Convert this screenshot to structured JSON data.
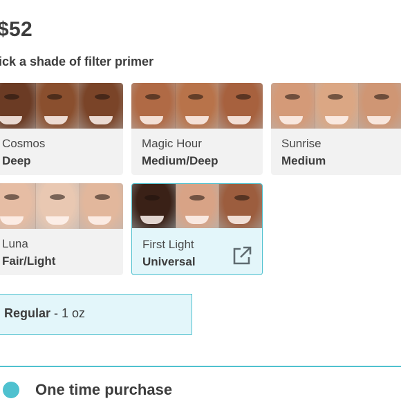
{
  "product": {
    "price": "$52",
    "shade_prompt": "ick a shade of filter primer"
  },
  "shades": [
    {
      "name": "Cosmos",
      "tone": "Deep",
      "selected": false,
      "skin_colors": [
        "#6b3b24",
        "#8a4f2e",
        "#7a4428"
      ]
    },
    {
      "name": "Magic Hour",
      "tone": "Medium/Deep",
      "selected": false,
      "skin_colors": [
        "#b06a45",
        "#b8734a",
        "#a7613e"
      ]
    },
    {
      "name": "Sunrise",
      "tone": "Medium",
      "selected": false,
      "skin_colors": [
        "#d49a78",
        "#dba784",
        "#cf9674"
      ]
    },
    {
      "name": "Luna",
      "tone": "Fair/Light",
      "selected": false,
      "skin_colors": [
        "#e6bda4",
        "#e9c8b2",
        "#e2b79c"
      ]
    },
    {
      "name": "First Light",
      "tone": "Universal",
      "selected": true,
      "skin_colors": [
        "#3a2117",
        "#d8a386",
        "#9c5d3e"
      ],
      "icon": "external-link-icon"
    }
  ],
  "size_option": {
    "label_bold": "Regular",
    "label_rest": " - 1 oz"
  },
  "purchase_option": {
    "label": "One time purchase"
  },
  "colors": {
    "accent": "#4fc1cf",
    "selected_bg": "#e3f6fa",
    "card_bg": "#f2f2f2"
  }
}
